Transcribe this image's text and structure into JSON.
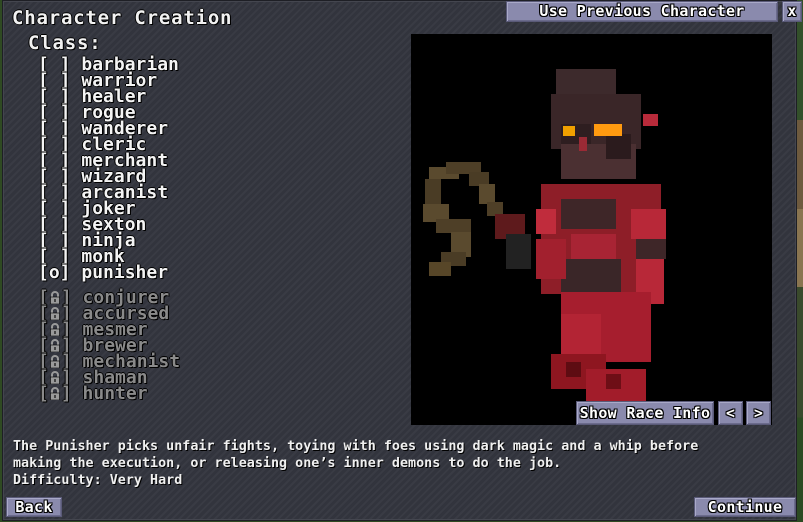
{
  "window": {
    "title": "Character Creation",
    "use_previous_label": "Use Previous Character",
    "close_label": "x"
  },
  "class_section": {
    "label": "Class:",
    "selected": "punisher",
    "classes": [
      {
        "box": "[ ]",
        "name": "barbarian"
      },
      {
        "box": "[ ]",
        "name": "warrior"
      },
      {
        "box": "[ ]",
        "name": "healer"
      },
      {
        "box": "[ ]",
        "name": "rogue"
      },
      {
        "box": "[ ]",
        "name": "wanderer"
      },
      {
        "box": "[ ]",
        "name": "cleric"
      },
      {
        "box": "[ ]",
        "name": "merchant"
      },
      {
        "box": "[ ]",
        "name": "wizard"
      },
      {
        "box": "[ ]",
        "name": "arcanist"
      },
      {
        "box": "[ ]",
        "name": "joker"
      },
      {
        "box": "[ ]",
        "name": "sexton"
      },
      {
        "box": "[ ]",
        "name": "ninja"
      },
      {
        "box": "[ ]",
        "name": "monk"
      },
      {
        "box": "[o]",
        "name": "punisher"
      }
    ],
    "locked_classes": [
      {
        "name": "conjurer",
        "icon": "lock-icon"
      },
      {
        "name": "accursed",
        "icon": "lock-icon"
      },
      {
        "name": "mesmer",
        "icon": "lock-icon"
      },
      {
        "name": "brewer",
        "icon": "lock-icon"
      },
      {
        "name": "mechanist",
        "icon": "lock-icon"
      },
      {
        "name": "shaman",
        "icon": "lock-icon"
      },
      {
        "name": "hunter",
        "icon": "lock-icon"
      }
    ]
  },
  "preview": {
    "show_race_info_label": "Show Race Info",
    "prev_label": "<",
    "next_label": ">"
  },
  "description": {
    "line1": "The Punisher picks unfair fights, toying with foes using dark magic and a whip before",
    "line2": "making the execution, or releasing one’s inner demons to do the job.",
    "difficulty": "Difficulty: Very Hard"
  },
  "footer": {
    "back_label": "Back",
    "continue_label": "Continue"
  },
  "colors": {
    "button_bg": "#8a8aad",
    "panel_bg": "#34363f",
    "locked_text": "#8a8a8a"
  }
}
